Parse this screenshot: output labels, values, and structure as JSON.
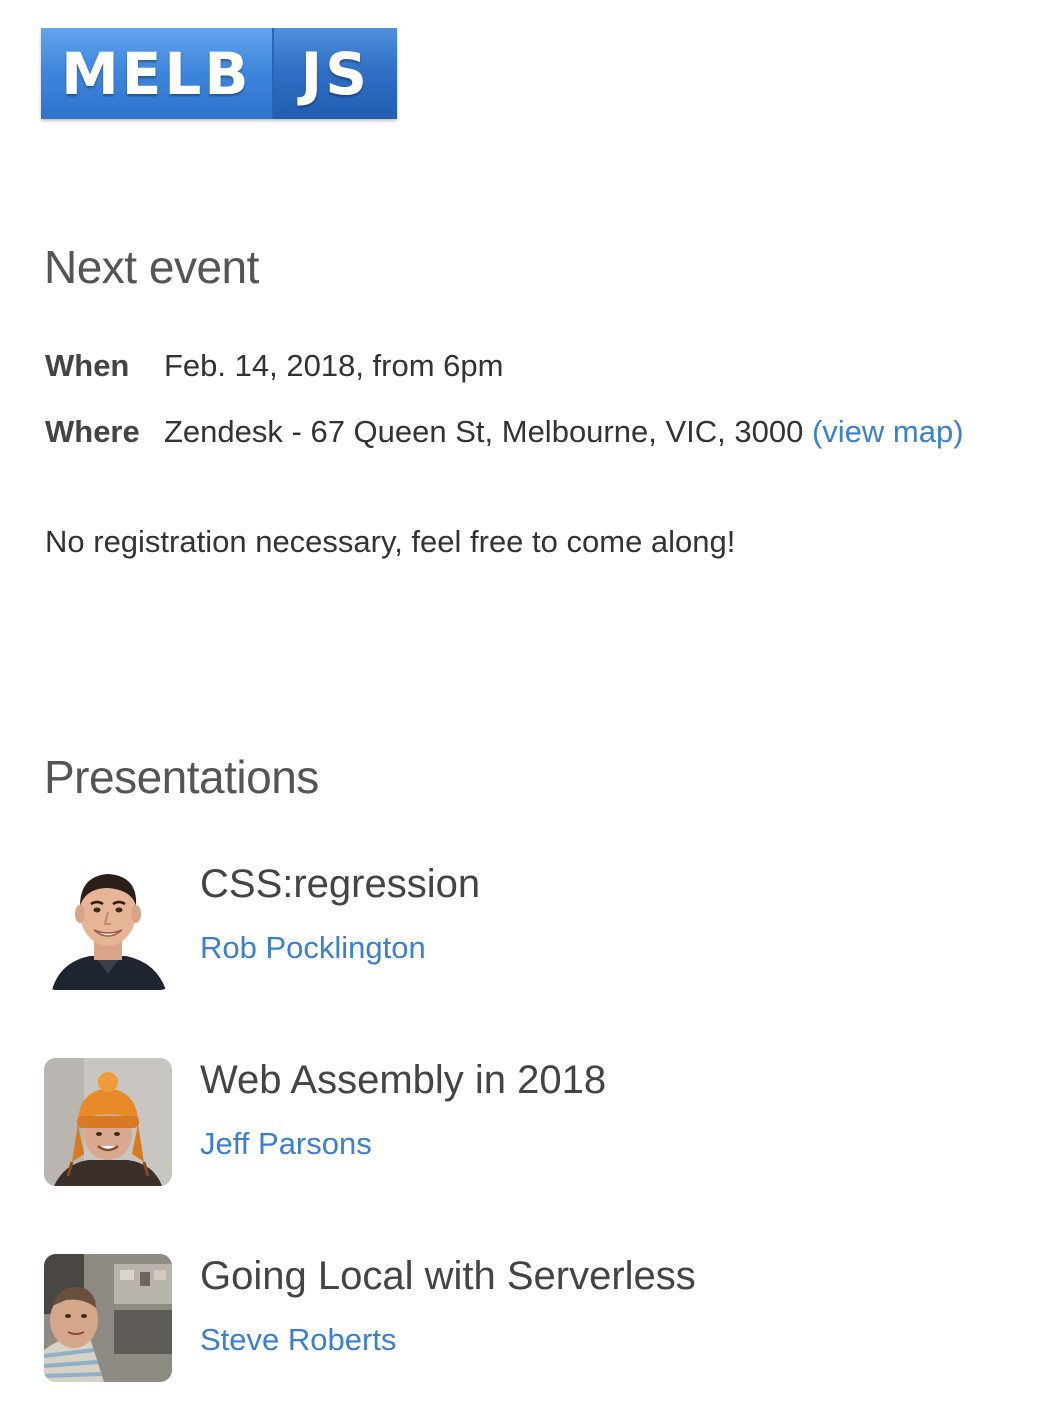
{
  "logo": {
    "left_text": "MELB",
    "right_text": "JS"
  },
  "next_event": {
    "heading": "Next event",
    "when_label": "When",
    "when_value": "Feb. 14, 2018, from 6pm",
    "where_label": "Where",
    "where_value": "Zendesk - 67 Queen St, Melbourne, VIC, 3000",
    "map_link": "(view map)",
    "note": "No registration necessary, feel free to come along!"
  },
  "presentations": {
    "heading": "Presentations",
    "items": [
      {
        "title": "CSS:regression",
        "speaker": "Rob Pocklington"
      },
      {
        "title": "Web Assembly in 2018",
        "speaker": "Jeff Parsons"
      },
      {
        "title": "Going Local with Serverless",
        "speaker": "Steve Roberts"
      }
    ]
  },
  "colors": {
    "link": "#3a7fd1",
    "logo_blue": "#3d85dc",
    "heading": "#555555"
  }
}
